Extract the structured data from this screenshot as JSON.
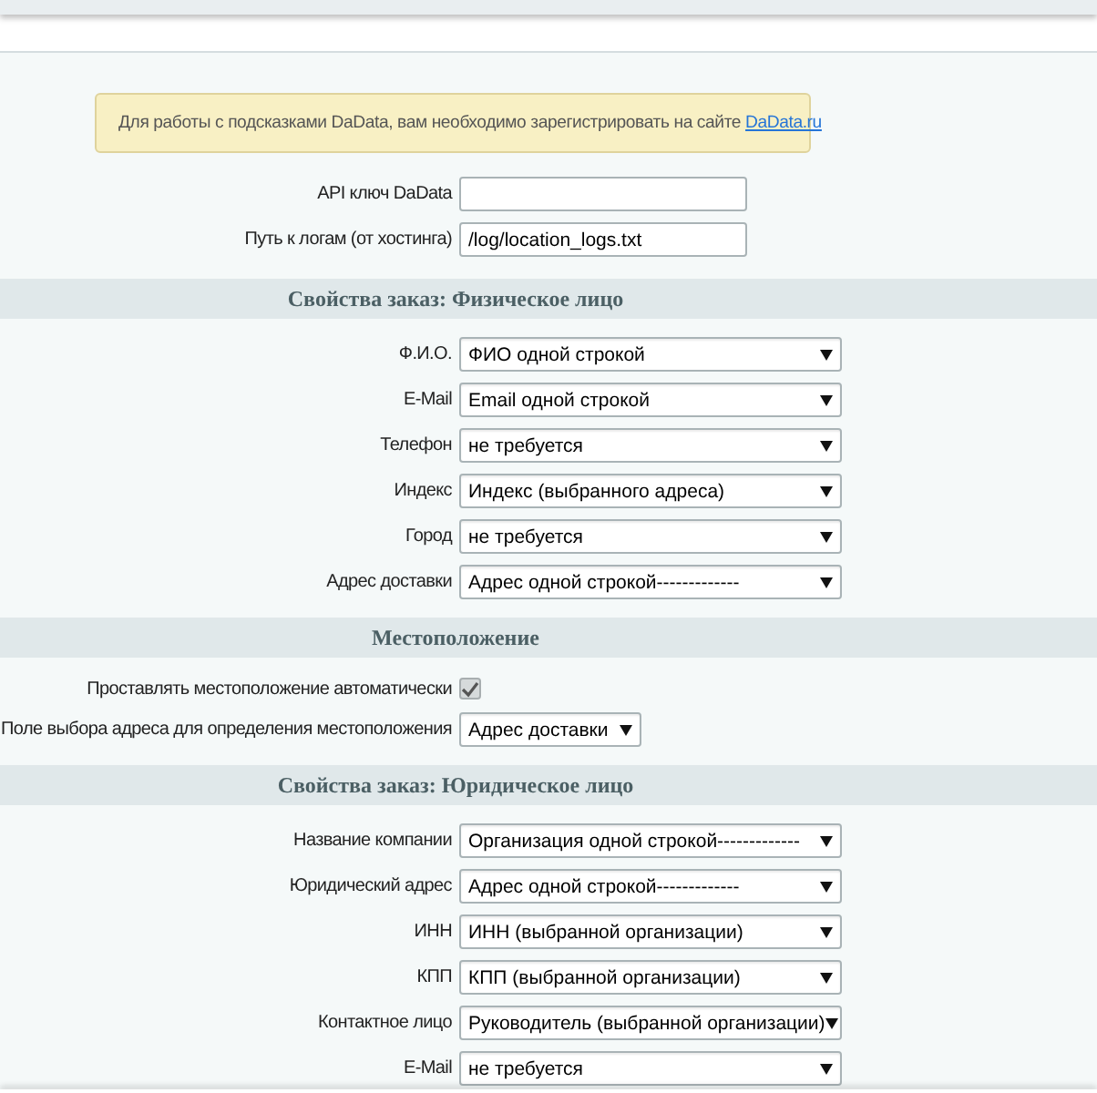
{
  "notice": {
    "text": "Для работы с подсказками DaData, вам необходимо зарегистрировать на сайте",
    "link": "DaData.ru"
  },
  "fields": [
    {
      "label": "API ключ DaData",
      "kind": "input"
    },
    {
      "label": "Путь к логам (от хостинга)",
      "kind": "input",
      "value": "/log/location_logs.txt"
    }
  ],
  "sections": [
    {
      "title": "Свойства заказ: Физическое лицо",
      "rows": [
        {
          "label": "Ф.И.О.",
          "kind": "select",
          "value": "ФИО одной строкой"
        },
        {
          "label": "E-Mail",
          "kind": "select",
          "value": "Email одной строкой"
        },
        {
          "label": "Телефон",
          "kind": "select",
          "value": "не требуется"
        },
        {
          "label": "Индекс",
          "kind": "select",
          "value": "Индекс (выбранного адреса)"
        },
        {
          "label": "Город",
          "kind": "select",
          "value": "не требуется"
        },
        {
          "label": "Адрес доставки",
          "kind": "select",
          "value": "Адрес одной строкой-------------"
        }
      ]
    },
    {
      "title": "Местоположение",
      "rows": [
        {
          "label": "Проставлять местоположение автоматически",
          "kind": "checkbox",
          "checked": true
        },
        {
          "label": "Поле выбора адреса для определения местоположения",
          "kind": "short-select",
          "value": "Адрес доставки"
        }
      ]
    },
    {
      "title": "Свойства заказ: Юридическое лицо",
      "rows": [
        {
          "label": "Название компании",
          "kind": "select",
          "value": "Организация одной строкой-------------"
        },
        {
          "label": "Юридический адрес",
          "kind": "select",
          "value": "Адрес одной строкой-------------"
        },
        {
          "label": "ИНН",
          "kind": "select",
          "value": "ИНН (выбранной организации)"
        },
        {
          "label": "КПП",
          "kind": "select",
          "value": "КПП (выбранной организации)"
        },
        {
          "label": "Контактное лицо",
          "kind": "select",
          "value": "Руководитель (выбранной организации)"
        },
        {
          "label": "E-Mail",
          "kind": "select",
          "value": "не требуется"
        }
      ]
    }
  ]
}
